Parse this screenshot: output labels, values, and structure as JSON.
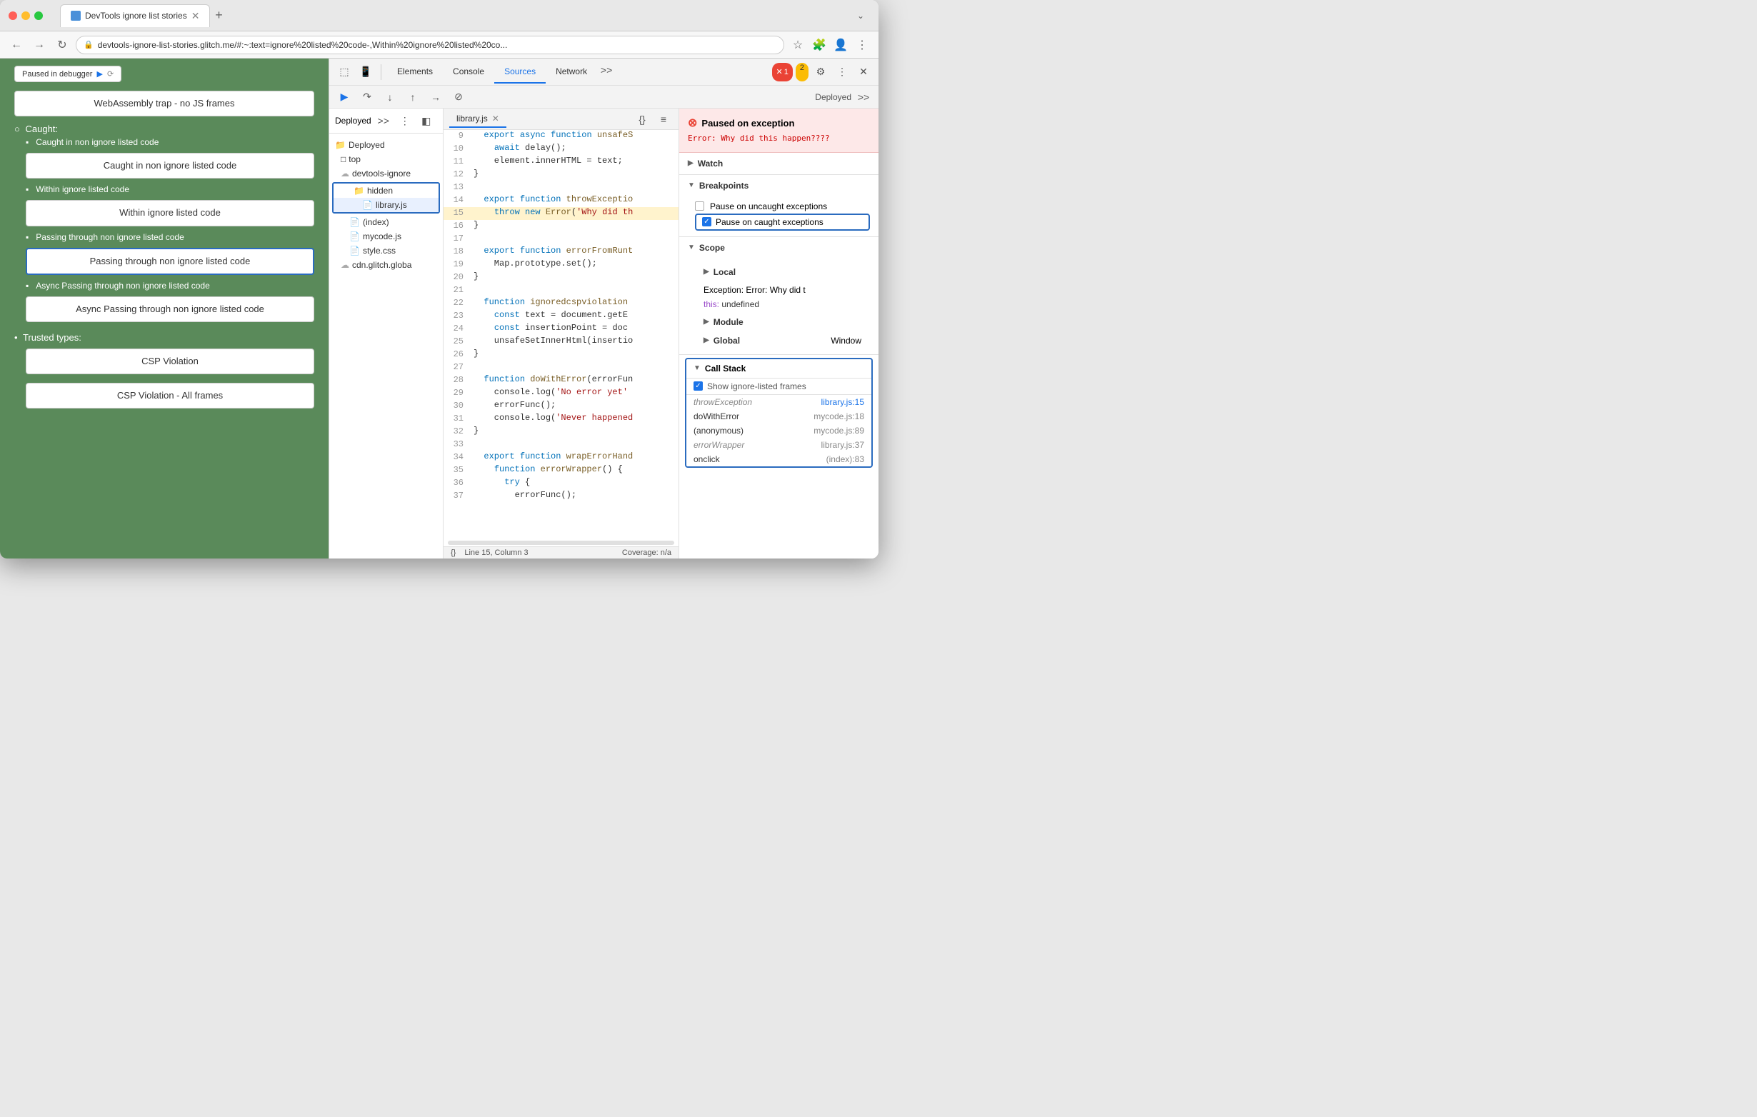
{
  "browser": {
    "title": "DevTools ignore list stories",
    "tab_label": "DevTools ignore list stories",
    "address": "devtools-ignore-list-stories.glitch.me/#:~:text=ignore%20listed%20code-,Within%20ignore%20listed%20co...",
    "new_tab_icon": "+",
    "back_icon": "←",
    "forward_icon": "→",
    "reload_icon": "↻"
  },
  "webpage": {
    "paused_label": "Paused in debugger",
    "webassembly_label": "WebAssembly trap - no JS frames",
    "caught_label": "Caught:",
    "items": [
      {
        "label": "Caught in non ignore listed code",
        "btn": "Caught in non ignore listed code",
        "active": false
      },
      {
        "label": "Within ignore listed code",
        "btn": "Within ignore listed code",
        "active": false
      },
      {
        "label": "Passing through non ignore listed code",
        "btn": "Passing through non ignore listed code",
        "active": true
      },
      {
        "label": "Async Passing through non ignore listed code",
        "btn": "Async Passing through non ignore listed code",
        "active": false
      }
    ],
    "trusted_label": "Trusted types:",
    "csp_btn1": "CSP Violation",
    "csp_btn2": "CSP Violation - All frames"
  },
  "devtools": {
    "toolbar": {
      "tabs": [
        "Elements",
        "Console",
        "Sources",
        "Network"
      ],
      "active_tab": "Sources",
      "more_label": ">>",
      "error_count": "1",
      "warn_count": "2"
    },
    "file_tree": {
      "deployed_label": "Deployed",
      "top_label": "top",
      "devtools_ignore_label": "devtools-ignore",
      "hidden_label": "hidden",
      "library_js_label": "library.js",
      "index_label": "(index)",
      "mycode_js_label": "mycode.js",
      "style_css_label": "style.css",
      "cdn_glitch_label": "cdn.glitch.globa"
    },
    "editor": {
      "tab_label": "library.js",
      "lines": [
        {
          "num": "9",
          "content": "  export async function unsafeS",
          "highlight": false
        },
        {
          "num": "10",
          "content": "    await delay();",
          "highlight": false
        },
        {
          "num": "11",
          "content": "    element.innerHTML = text;",
          "highlight": false
        },
        {
          "num": "12",
          "content": "}",
          "highlight": false
        },
        {
          "num": "13",
          "content": "",
          "highlight": false
        },
        {
          "num": "14",
          "content": "  export function throwExceptio",
          "highlight": false
        },
        {
          "num": "15",
          "content": "    throw new Error('Why did th",
          "highlight": true
        },
        {
          "num": "16",
          "content": "}",
          "highlight": false
        },
        {
          "num": "17",
          "content": "",
          "highlight": false
        },
        {
          "num": "18",
          "content": "  export function errorFromRunt",
          "highlight": false
        },
        {
          "num": "19",
          "content": "    Map.prototype.set();",
          "highlight": false
        },
        {
          "num": "20",
          "content": "}",
          "highlight": false
        },
        {
          "num": "21",
          "content": "",
          "highlight": false
        },
        {
          "num": "22",
          "content": "  function ignoredcspviolation",
          "highlight": false
        },
        {
          "num": "23",
          "content": "    const text = document.getE",
          "highlight": false
        },
        {
          "num": "24",
          "content": "    const insertionPoint = doc",
          "highlight": false
        },
        {
          "num": "25",
          "content": "    unsafeSetInnerHtml(insertio",
          "highlight": false
        },
        {
          "num": "26",
          "content": "}",
          "highlight": false
        },
        {
          "num": "27",
          "content": "",
          "highlight": false
        },
        {
          "num": "28",
          "content": "  function doWithError(errorFun",
          "highlight": false
        },
        {
          "num": "29",
          "content": "    console.log('No error yet'",
          "highlight": false
        },
        {
          "num": "30",
          "content": "    errorFunc();",
          "highlight": false
        },
        {
          "num": "31",
          "content": "    console.log('Never happened",
          "highlight": false
        },
        {
          "num": "32",
          "content": "}",
          "highlight": false
        },
        {
          "num": "33",
          "content": "",
          "highlight": false
        },
        {
          "num": "34",
          "content": "  export function wrapErrorHand",
          "highlight": false
        },
        {
          "num": "35",
          "content": "    function errorWrapper() {",
          "highlight": false
        },
        {
          "num": "36",
          "content": "      try {",
          "highlight": false
        },
        {
          "num": "37",
          "content": "        errorFunc();",
          "highlight": false
        }
      ],
      "status_line": "Line 15, Column 3",
      "status_coverage": "Coverage: n/a"
    },
    "right_panel": {
      "exception_title": "Paused on exception",
      "exception_message": "Error: Why did this\nhappen????",
      "sections": {
        "watch_label": "Watch",
        "breakpoints_label": "Breakpoints",
        "pause_uncaught_label": "Pause on uncaught exceptions",
        "pause_caught_label": "Pause on caught exceptions",
        "scope_label": "Scope",
        "local_label": "Local",
        "exception_scope": "Exception: Error: Why did t",
        "this_scope": "this:  undefined",
        "module_label": "Module",
        "global_label": "Global",
        "global_value": "Window",
        "call_stack_label": "Call Stack",
        "show_ignore_label": "Show ignore-listed frames",
        "call_stack_items": [
          {
            "fn": "throwException",
            "loc": "library.js:15",
            "italic": true,
            "active": true
          },
          {
            "fn": "doWithError",
            "loc": "mycode.js:18",
            "italic": false,
            "active": false
          },
          {
            "fn": "(anonymous)",
            "loc": "mycode.js:89",
            "italic": false,
            "active": false
          },
          {
            "fn": "errorWrapper",
            "loc": "library.js:37",
            "italic": true,
            "active": false
          },
          {
            "fn": "onclick",
            "loc": "(index):83",
            "italic": false,
            "active": false
          }
        ]
      }
    }
  }
}
